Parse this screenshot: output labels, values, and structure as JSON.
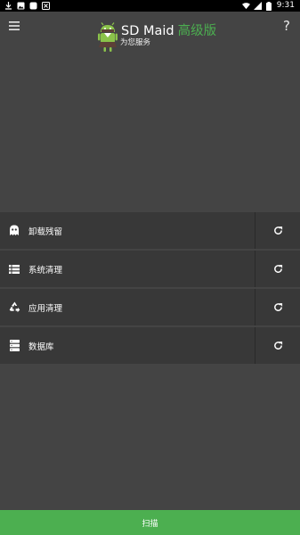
{
  "status_bar": {
    "left_icons": [
      "download-icon",
      "image-icon",
      "app-icon",
      "notification-icon"
    ],
    "right_icons": [
      "wifi-icon",
      "signal-icon",
      "battery-icon"
    ],
    "time": "9:31"
  },
  "header": {
    "app_title": "SD Maid",
    "pro_badge": "高级版",
    "subtitle": "为您服务",
    "menu_icon": "hamburger-menu-icon",
    "help_label": "?"
  },
  "tools": [
    {
      "label": "卸载残留",
      "icon": "ghost-icon"
    },
    {
      "label": "系统清理",
      "icon": "list-icon"
    },
    {
      "label": "应用清理",
      "icon": "recycle-icon"
    },
    {
      "label": "数据库",
      "icon": "database-icon"
    }
  ],
  "scan_button": {
    "label": "扫描"
  },
  "colors": {
    "background": "#444444",
    "row": "#383838",
    "accent": "#4caf50",
    "status_bar": "#000000"
  }
}
